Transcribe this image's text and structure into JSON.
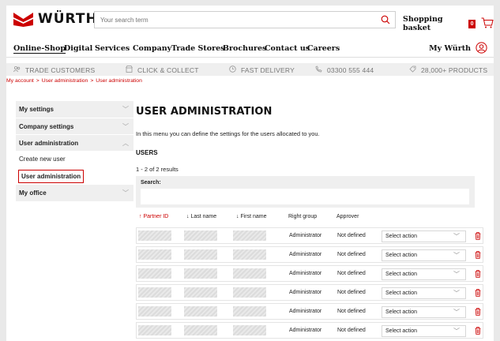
{
  "header": {
    "logo_text": "WÜRTH",
    "search_placeholder": "Your search term",
    "basket_label": "Shopping basket",
    "basket_count": "0"
  },
  "nav": {
    "items": [
      "Online-Shop",
      "Digital",
      "Services",
      "Company",
      "Trade Stores",
      "Brochures",
      "Contact us",
      "Careers"
    ],
    "account_label": "My Würth"
  },
  "infobar": {
    "items": [
      "TRADE CUSTOMERS",
      "CLICK & COLLECT",
      "FAST DELIVERY",
      "03300 555 444",
      "28,000+ PRODUCTS"
    ]
  },
  "breadcrumb": [
    "My account",
    "User administration",
    "User administration"
  ],
  "sidebar": {
    "items": [
      {
        "label": "My settings",
        "type": "group"
      },
      {
        "label": "Company settings",
        "type": "group"
      },
      {
        "label": "User administration",
        "type": "group-open"
      },
      {
        "label": "Create new user",
        "type": "sub"
      },
      {
        "label": "User administration",
        "type": "sub-current"
      },
      {
        "label": "My office",
        "type": "group"
      }
    ]
  },
  "main": {
    "title": "USER ADMINISTRATION",
    "intro": "In this menu you can define the settings for the users allocated to you.",
    "users_heading": "USERS",
    "results": "1 - 2 of 2 results",
    "search_label": "Search:",
    "columns": [
      "↑ Partner ID",
      "↓ Last name",
      "↓ First name",
      "Right group",
      "Approver"
    ],
    "rows": [
      {
        "right_group": "Administrator",
        "approver": "Not defined",
        "action": "Select action"
      },
      {
        "right_group": "Administrator",
        "approver": "Not defined",
        "action": "Select action"
      },
      {
        "right_group": "Administrator",
        "approver": "Not defined",
        "action": "Select action"
      },
      {
        "right_group": "Administrator",
        "approver": "Not defined",
        "action": "Select action"
      },
      {
        "right_group": "Administrator",
        "approver": "Not defined",
        "action": "Select action"
      },
      {
        "right_group": "Administrator",
        "approver": "Not defined",
        "action": "Select action"
      }
    ]
  },
  "colors": {
    "brand_red": "#cc0000",
    "panel_grey": "#efefef"
  }
}
